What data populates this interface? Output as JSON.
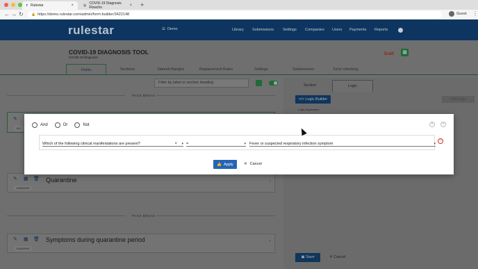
{
  "browser": {
    "tabs": [
      {
        "title": "Rulestar",
        "active": true
      },
      {
        "title": "COVID-19 Diagnosis Flowcho",
        "active": false
      }
    ],
    "url": "https://demo.rulestar.com/admin/form-builder/3422148",
    "profile": "Guest"
  },
  "app": {
    "logo": "rulestar",
    "workspace": "Demo",
    "nav": [
      "Library",
      "Submissions",
      "Settings",
      "Companies",
      "Users",
      "Payments",
      "Reports"
    ],
    "colors": {
      "header": "#0d3560",
      "accent": "#1f6b35",
      "primary_button": "#2566b4"
    }
  },
  "form": {
    "title": "COVID-19 DIAGNOSIS TOOL",
    "subtitle": "COVID-19 Diagnosis",
    "status": "Draft",
    "tabs": [
      "Fields",
      "Sections",
      "Named Ranges",
      "Replacement Rules",
      "Settings",
      "Submissions",
      "Error checking"
    ],
    "filter_placeholder": "Filter by label or section heading",
    "page_break": "PAGE BREAK",
    "cards": [
      {
        "label": "",
        "id": "100"
      },
      {
        "label": "Quarantine",
        "id": "100633937"
      },
      {
        "label": "Symptoms during quarantine period",
        "id": "100633997"
      }
    ]
  },
  "right_panel": {
    "tabs": [
      "Section",
      "Logic"
    ],
    "logic_builder": "Logic Builder",
    "edit_logic": "Edit Logic",
    "logic_expression": "Logic Expression",
    "save": "Save",
    "cancel": "Cancel"
  },
  "modal": {
    "operators": [
      "And",
      "Or",
      "Not"
    ],
    "condition": {
      "question": "Which of the following clinical manifestations are present?",
      "operator": "=",
      "value": "Fever or suspected respiratory infection symptom"
    },
    "apply": "Apply",
    "cancel": "Cancel"
  }
}
